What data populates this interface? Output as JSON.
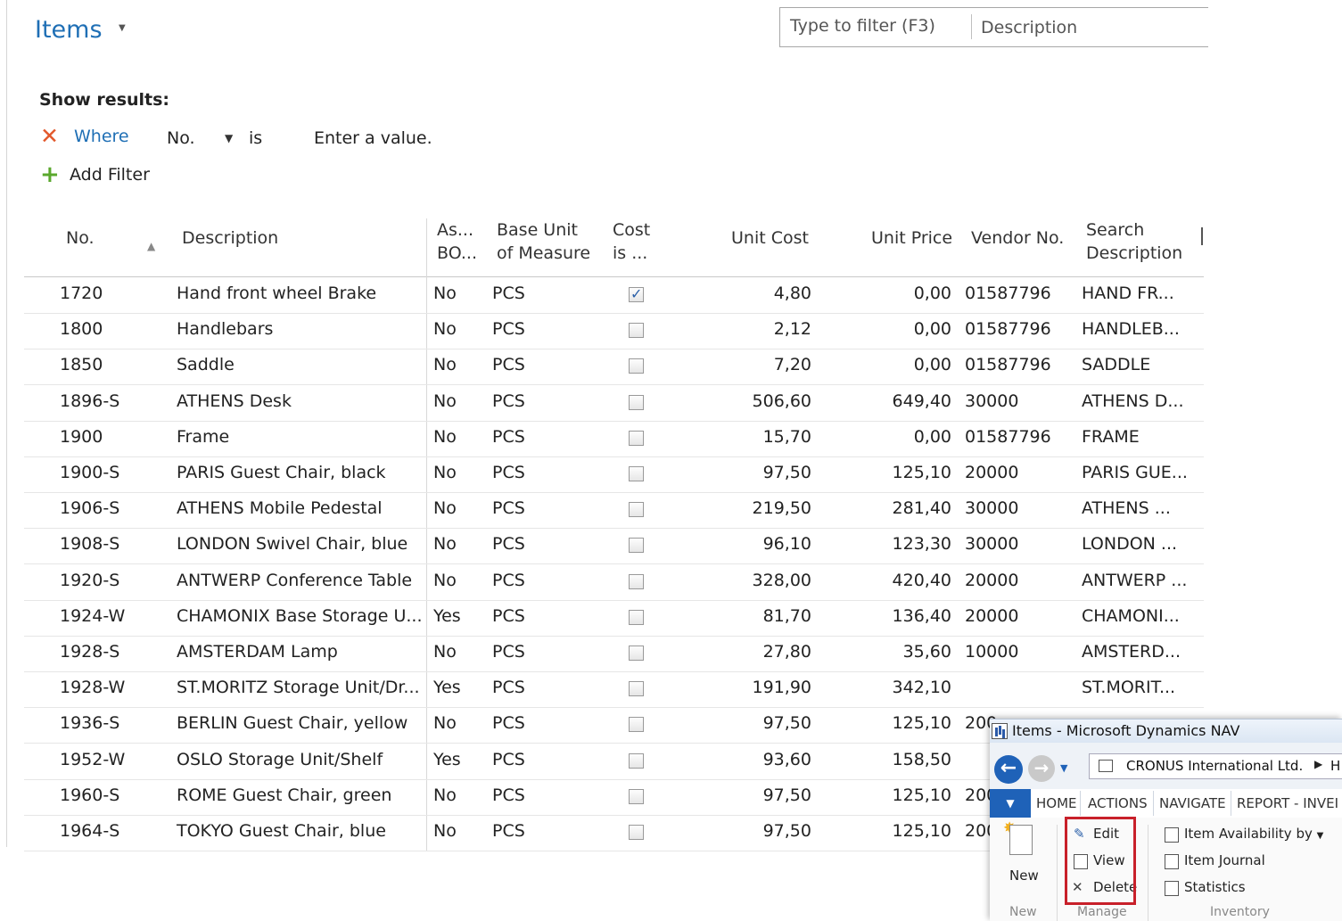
{
  "page": {
    "title": "Items",
    "filter_placeholder": "Type to filter (F3)",
    "filter_field": "Description"
  },
  "filters": {
    "show_results_label": "Show results:",
    "where_label": "Where",
    "field": "No.",
    "operator": "is",
    "value_placeholder": "Enter a value.",
    "add_filter_label": "Add Filter"
  },
  "table": {
    "columns": {
      "no": "No.",
      "description": "Description",
      "assembly_bom_1": "As...",
      "assembly_bom_2": "BO...",
      "uom_1": "Base Unit",
      "uom_2": "of Measure",
      "cost_adj_1": "Cost",
      "cost_adj_2": "is ...",
      "unit_cost": "Unit Cost",
      "unit_price": "Unit Price",
      "vendor_no": "Vendor No.",
      "search_1": "Search",
      "search_2": "Description"
    },
    "rows": [
      {
        "no": "1720",
        "description": "Hand front wheel Brake",
        "asm": "No",
        "uom": "PCS",
        "cost_adjusted": true,
        "unit_cost": "4,80",
        "unit_price": "0,00",
        "vendor": "01587796",
        "search": "HAND FR..."
      },
      {
        "no": "1800",
        "description": "Handlebars",
        "asm": "No",
        "uom": "PCS",
        "cost_adjusted": false,
        "unit_cost": "2,12",
        "unit_price": "0,00",
        "vendor": "01587796",
        "search": "HANDLEB..."
      },
      {
        "no": "1850",
        "description": "Saddle",
        "asm": "No",
        "uom": "PCS",
        "cost_adjusted": false,
        "unit_cost": "7,20",
        "unit_price": "0,00",
        "vendor": "01587796",
        "search": "SADDLE"
      },
      {
        "no": "1896-S",
        "description": "ATHENS Desk",
        "asm": "No",
        "uom": "PCS",
        "cost_adjusted": false,
        "unit_cost": "506,60",
        "unit_price": "649,40",
        "vendor": "30000",
        "search": "ATHENS D..."
      },
      {
        "no": "1900",
        "description": "Frame",
        "asm": "No",
        "uom": "PCS",
        "cost_adjusted": false,
        "unit_cost": "15,70",
        "unit_price": "0,00",
        "vendor": "01587796",
        "search": "FRAME"
      },
      {
        "no": "1900-S",
        "description": "PARIS Guest Chair, black",
        "asm": "No",
        "uom": "PCS",
        "cost_adjusted": false,
        "unit_cost": "97,50",
        "unit_price": "125,10",
        "vendor": "20000",
        "search": "PARIS GUE..."
      },
      {
        "no": "1906-S",
        "description": "ATHENS Mobile Pedestal",
        "asm": "No",
        "uom": "PCS",
        "cost_adjusted": false,
        "unit_cost": "219,50",
        "unit_price": "281,40",
        "vendor": "30000",
        "search": "ATHENS ..."
      },
      {
        "no": "1908-S",
        "description": "LONDON Swivel Chair, blue",
        "asm": "No",
        "uom": "PCS",
        "cost_adjusted": false,
        "unit_cost": "96,10",
        "unit_price": "123,30",
        "vendor": "30000",
        "search": "LONDON ..."
      },
      {
        "no": "1920-S",
        "description": "ANTWERP Conference Table",
        "asm": "No",
        "uom": "PCS",
        "cost_adjusted": false,
        "unit_cost": "328,00",
        "unit_price": "420,40",
        "vendor": "20000",
        "search": "ANTWERP ..."
      },
      {
        "no": "1924-W",
        "description": "CHAMONIX Base Storage U...",
        "asm": "Yes",
        "uom": "PCS",
        "cost_adjusted": false,
        "unit_cost": "81,70",
        "unit_price": "136,40",
        "vendor": "20000",
        "search": "CHAMONI..."
      },
      {
        "no": "1928-S",
        "description": "AMSTERDAM Lamp",
        "asm": "No",
        "uom": "PCS",
        "cost_adjusted": false,
        "unit_cost": "27,80",
        "unit_price": "35,60",
        "vendor": "10000",
        "search": "AMSTERD..."
      },
      {
        "no": "1928-W",
        "description": "ST.MORITZ Storage Unit/Dr...",
        "asm": "Yes",
        "uom": "PCS",
        "cost_adjusted": false,
        "unit_cost": "191,90",
        "unit_price": "342,10",
        "vendor": "",
        "search": "ST.MORIT..."
      },
      {
        "no": "1936-S",
        "description": "BERLIN Guest Chair, yellow",
        "asm": "No",
        "uom": "PCS",
        "cost_adjusted": false,
        "unit_cost": "97,50",
        "unit_price": "125,10",
        "vendor": "200",
        "search": ""
      },
      {
        "no": "1952-W",
        "description": "OSLO Storage Unit/Shelf",
        "asm": "Yes",
        "uom": "PCS",
        "cost_adjusted": false,
        "unit_cost": "93,60",
        "unit_price": "158,50",
        "vendor": "",
        "search": ""
      },
      {
        "no": "1960-S",
        "description": "ROME Guest Chair, green",
        "asm": "No",
        "uom": "PCS",
        "cost_adjusted": false,
        "unit_cost": "97,50",
        "unit_price": "125,10",
        "vendor": "200",
        "search": ""
      },
      {
        "no": "1964-S",
        "description": "TOKYO Guest Chair, blue",
        "asm": "No",
        "uom": "PCS",
        "cost_adjusted": false,
        "unit_cost": "97,50",
        "unit_price": "125,10",
        "vendor": "200",
        "search": ""
      }
    ]
  },
  "nav_window": {
    "title": "Items - Microsoft Dynamics NAV",
    "company": "CRONUS International Ltd.",
    "address_more": "H",
    "tabs": [
      "HOME",
      "ACTIONS",
      "NAVIGATE",
      "REPORT - INVEI"
    ],
    "ribbon": {
      "new_label": "New",
      "new_group": "New",
      "edit_label": "Edit",
      "view_label": "View",
      "delete_label": "Delete",
      "manage_group": "Manage",
      "item_availability_label": "Item Availability by",
      "item_journal_label": "Item Journal",
      "statistics_label": "Statistics",
      "inventory_group": "Inventory"
    }
  },
  "colors": {
    "accent": "#1f6fb5",
    "remove": "#e2582b",
    "add": "#5aa82d",
    "nav_blue": "#1f62b8",
    "highlight": "#c8202a"
  },
  "icons": [
    "chevron-down-icon",
    "close-icon",
    "plus-icon",
    "sort-asc-icon",
    "checkbox-icon",
    "back-arrow-icon",
    "forward-arrow-icon",
    "new-document-icon",
    "pencil-icon",
    "magnifier-icon",
    "delete-x-icon",
    "chart-icon",
    "journal-icon",
    "statistics-icon"
  ]
}
